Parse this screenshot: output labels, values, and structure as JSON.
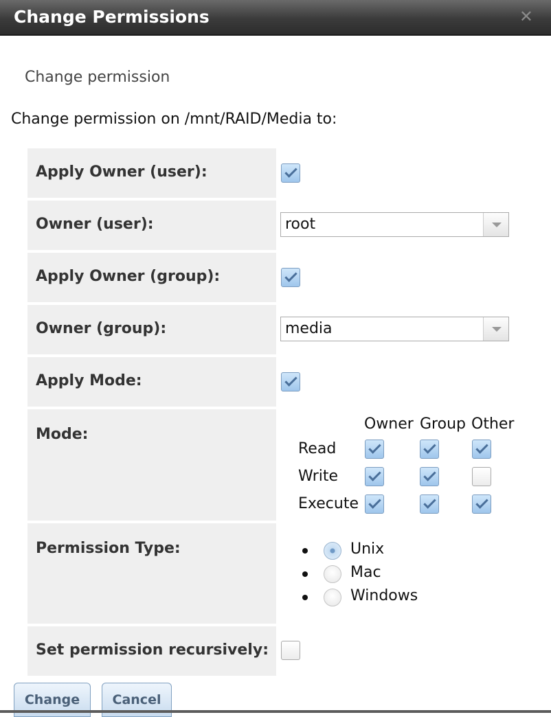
{
  "dialog": {
    "title": "Change Permissions",
    "close_glyph": "✕"
  },
  "form": {
    "subtitle": "Change permission",
    "intro": "Change permission on /mnt/RAID/Media to:",
    "apply_owner_user": {
      "label": "Apply Owner (user):",
      "checked": true
    },
    "owner_user": {
      "label": "Owner (user):",
      "value": "root"
    },
    "apply_owner_group": {
      "label": "Apply Owner (group):",
      "checked": true
    },
    "owner_group": {
      "label": "Owner (group):",
      "value": "media"
    },
    "apply_mode": {
      "label": "Apply Mode:",
      "checked": true
    },
    "mode": {
      "label": "Mode:",
      "columns": [
        "Owner",
        "Group",
        "Other"
      ],
      "rows": [
        {
          "label": "Read",
          "values": [
            true,
            true,
            true
          ]
        },
        {
          "label": "Write",
          "values": [
            true,
            true,
            false
          ]
        },
        {
          "label": "Execute",
          "values": [
            true,
            true,
            true
          ]
        }
      ]
    },
    "permission_type": {
      "label": "Permission Type:",
      "options": [
        "Unix",
        "Mac",
        "Windows"
      ],
      "selected": "Unix"
    },
    "recursive": {
      "label": "Set permission recursively:",
      "checked": false
    }
  },
  "buttons": {
    "change": "Change",
    "cancel": "Cancel"
  },
  "colors": {
    "titlebar": "#3b3b3b",
    "row_bg": "#efefef",
    "check_accent": "#9fc6ec",
    "button_text": "#4a6078"
  }
}
